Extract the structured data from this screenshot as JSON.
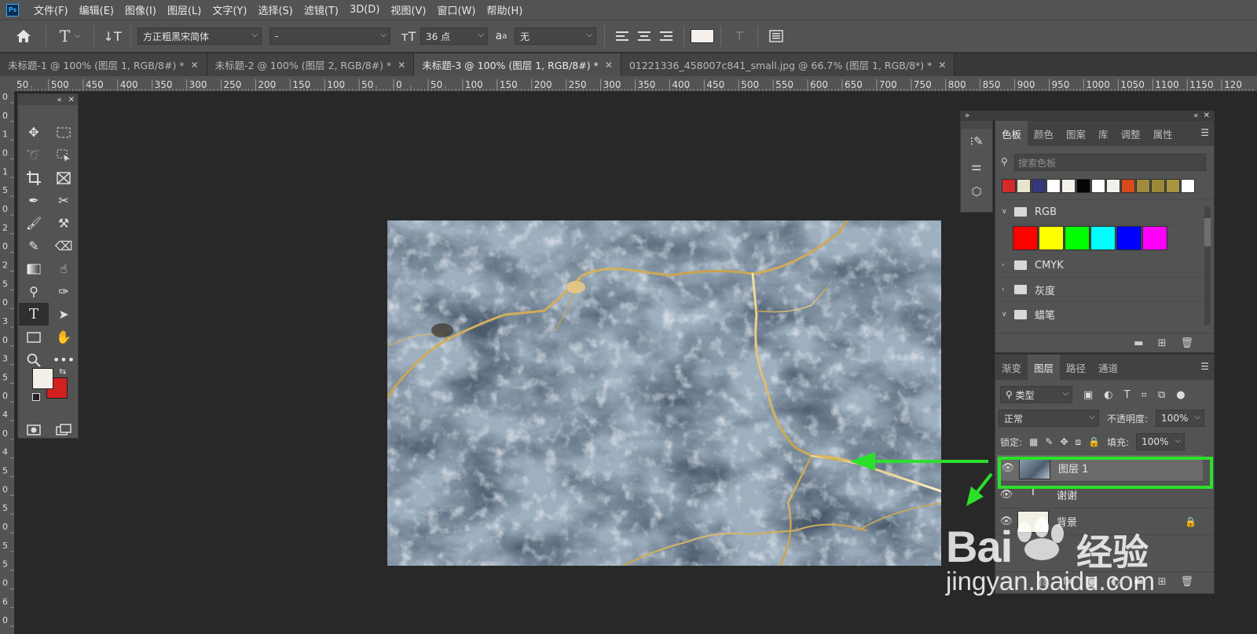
{
  "app": {
    "logo_text": "Ps"
  },
  "menu": [
    "文件(F)",
    "编辑(E)",
    "图像(I)",
    "图层(L)",
    "文字(Y)",
    "选择(S)",
    "滤镜(T)",
    "3D(D)",
    "视图(V)",
    "窗口(W)",
    "帮助(H)"
  ],
  "options": {
    "font_family": "方正粗黑宋简体",
    "font_style": "-",
    "font_size": "36 点",
    "aa_label": "a",
    "anti_alias": "无",
    "text_color": "#f5f1ea"
  },
  "tabs": [
    {
      "label": "未标题-1 @ 100% (图层 1, RGB/8#) *",
      "active": false
    },
    {
      "label": "未标题-2 @ 100% (图层 2, RGB/8#) *",
      "active": false
    },
    {
      "label": "未标题-3 @ 100% (图层 1, RGB/8#) *",
      "active": true
    },
    {
      "label": "01221336_458007c841_small.jpg @ 66.7% (图层 1, RGB/8*) *",
      "active": false
    }
  ],
  "ruler_h_labels": [
    "50",
    "500",
    "450",
    "400",
    "350",
    "300",
    "250",
    "200",
    "150",
    "100",
    "50",
    "0",
    "50",
    "100",
    "150",
    "200",
    "250",
    "300",
    "350",
    "400",
    "450",
    "500",
    "550",
    "600",
    "650",
    "700",
    "750",
    "800",
    "850",
    "900",
    "950",
    "1000",
    "1050",
    "1100",
    "1150",
    "120"
  ],
  "ruler_v_labels": [
    "0",
    "0",
    "1",
    "0",
    "1",
    "5",
    "0",
    "2",
    "0",
    "2",
    "5",
    "0",
    "3",
    "0",
    "3",
    "5",
    "0",
    "4",
    "0",
    "4",
    "5",
    "0",
    "5",
    "0",
    "5",
    "5",
    "0",
    "6",
    "0"
  ],
  "toolbox": {
    "tools": [
      "move-tool",
      "marquee-tool",
      "lasso-tool",
      "object-select-tool",
      "crop-tool",
      "frame-tool",
      "eyedropper-tool",
      "patch-tool",
      "brush-tool",
      "stamp-tool",
      "history-brush-tool",
      "eraser-tool",
      "gradient-tool",
      "smudge-tool",
      "dodge-tool",
      "pen-tool",
      "type-tool",
      "path-select-tool",
      "rectangle-tool",
      "hand-tool",
      "zoom-tool",
      "more-tools",
      "quick-mask-tool",
      "screen-mode-tool"
    ],
    "foreground": "#f3efe8",
    "background": "#d42020"
  },
  "swatches_panel": {
    "tabs": [
      "色板",
      "颜色",
      "图案",
      "库",
      "调整",
      "属性"
    ],
    "active_tab": "色板",
    "search_placeholder": "搜索色板",
    "recent": [
      "#d42a2a",
      "#e9e4cd",
      "#34387a",
      "#ffffff",
      "#f4f1ea",
      "#050505",
      "#ffffff",
      "#f2f0ea",
      "#d84a1a",
      "#a08a3c",
      "#9c8a3a",
      "#a89440",
      "#ffffff"
    ],
    "groups": [
      {
        "name": "RGB",
        "expanded": true,
        "colors": [
          "#ff0000",
          "#ffff00",
          "#00ff00",
          "#00ffff",
          "#0000ff",
          "#ff00ff"
        ]
      },
      {
        "name": "CMYK",
        "expanded": false
      },
      {
        "name": "灰度",
        "expanded": false
      },
      {
        "name": "蜡笔",
        "expanded": true
      }
    ]
  },
  "layers_panel": {
    "tabs": [
      "渐变",
      "图层",
      "路径",
      "通道"
    ],
    "active_tab": "图层",
    "filter_kind": "类型",
    "blend_mode": "正常",
    "opacity_label": "不透明度:",
    "opacity": "100%",
    "lock_label": "锁定:",
    "fill_label": "填充:",
    "fill": "100%",
    "layers": [
      {
        "name": "图层 1",
        "type": "image",
        "selected": true
      },
      {
        "name": "谢谢",
        "type": "text",
        "selected": false
      },
      {
        "name": "背景",
        "type": "background",
        "selected": false,
        "locked": true
      }
    ]
  },
  "annotation": {
    "highlight_color": "#2be02b"
  },
  "watermark": {
    "brand": "Bai",
    "brand2": "经验",
    "url": "jingyan.baidu.com"
  }
}
